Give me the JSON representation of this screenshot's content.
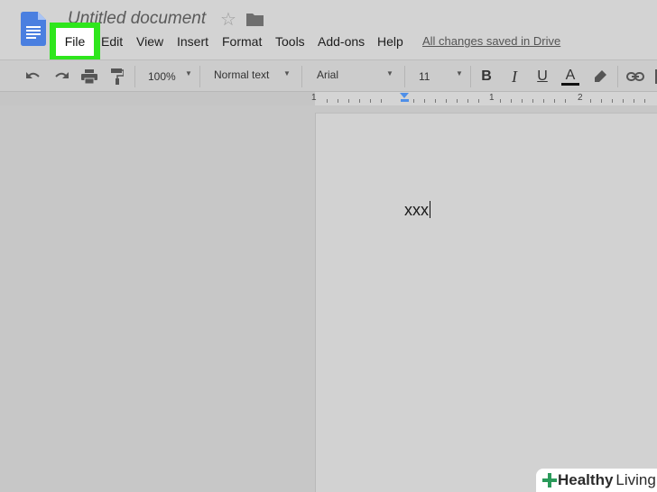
{
  "header": {
    "title": "Untitled document",
    "saved_status": "All changes saved in Drive"
  },
  "menu": {
    "items": [
      "File",
      "Edit",
      "View",
      "Insert",
      "Format",
      "Tools",
      "Add-ons",
      "Help"
    ],
    "highlighted_item": "File",
    "highlight_color": "#2ee61c"
  },
  "toolbar": {
    "zoom": "100%",
    "paragraph_style": "Normal text",
    "font": "Arial",
    "font_size": "11",
    "bold_label": "B",
    "italic_label": "I",
    "underline_label": "U",
    "text_color_label": "A",
    "icons": [
      "undo-icon",
      "redo-icon",
      "print-icon",
      "paint-format-icon",
      "highlighter-icon",
      "link-icon"
    ]
  },
  "ruler": {
    "labels": [
      "1",
      "1",
      "2"
    ],
    "marker_color": "#4f8fe8"
  },
  "document": {
    "body_text": "xxx"
  },
  "watermark": {
    "brand_bold": "Healthy",
    "brand_light": "Living",
    "accent_color": "#2a9a5a"
  }
}
